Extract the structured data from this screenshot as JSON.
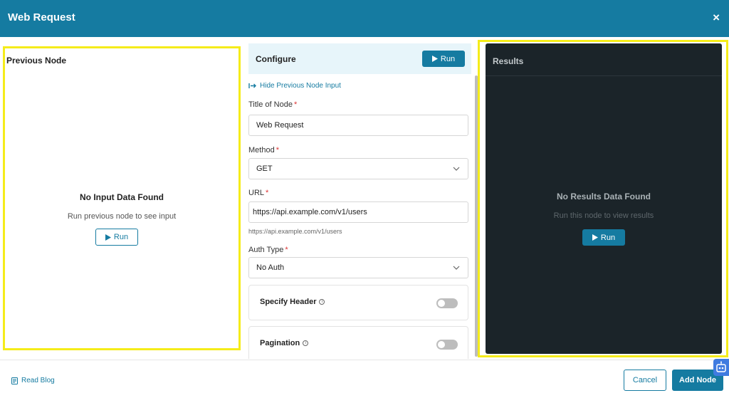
{
  "header": {
    "title": "Web Request",
    "close_label": "×"
  },
  "previous_node": {
    "title": "Previous Node",
    "empty_title": "No Input Data Found",
    "empty_subtitle": "Run previous node to see input",
    "run_label": "Run"
  },
  "configure": {
    "title": "Configure",
    "run_label": "Run",
    "hide_link": "Hide Previous Node Input",
    "title_of_node": {
      "label": "Title of Node",
      "required": "*",
      "value": "Web Request"
    },
    "method": {
      "label": "Method",
      "required": "*",
      "value": "GET"
    },
    "url": {
      "label": "URL",
      "required": "*",
      "value": "https://api.example.com/v1/users",
      "helper": "https://api.example.com/v1/users"
    },
    "auth_type": {
      "label": "Auth Type",
      "required": "*",
      "value": "No Auth"
    },
    "specify_header": {
      "label": "Specify Header",
      "enabled": false
    },
    "pagination": {
      "label": "Pagination",
      "enabled": false
    }
  },
  "results": {
    "title": "Results",
    "empty_title": "No Results Data Found",
    "empty_subtitle": "Run this node to view results",
    "run_label": "Run"
  },
  "footer": {
    "read_blog": "Read Blog",
    "cancel": "Cancel",
    "add_node": "Add Node"
  },
  "colors": {
    "primary": "#157ba1",
    "highlight": "#f5ec1a",
    "results_bg": "#1b2429"
  }
}
